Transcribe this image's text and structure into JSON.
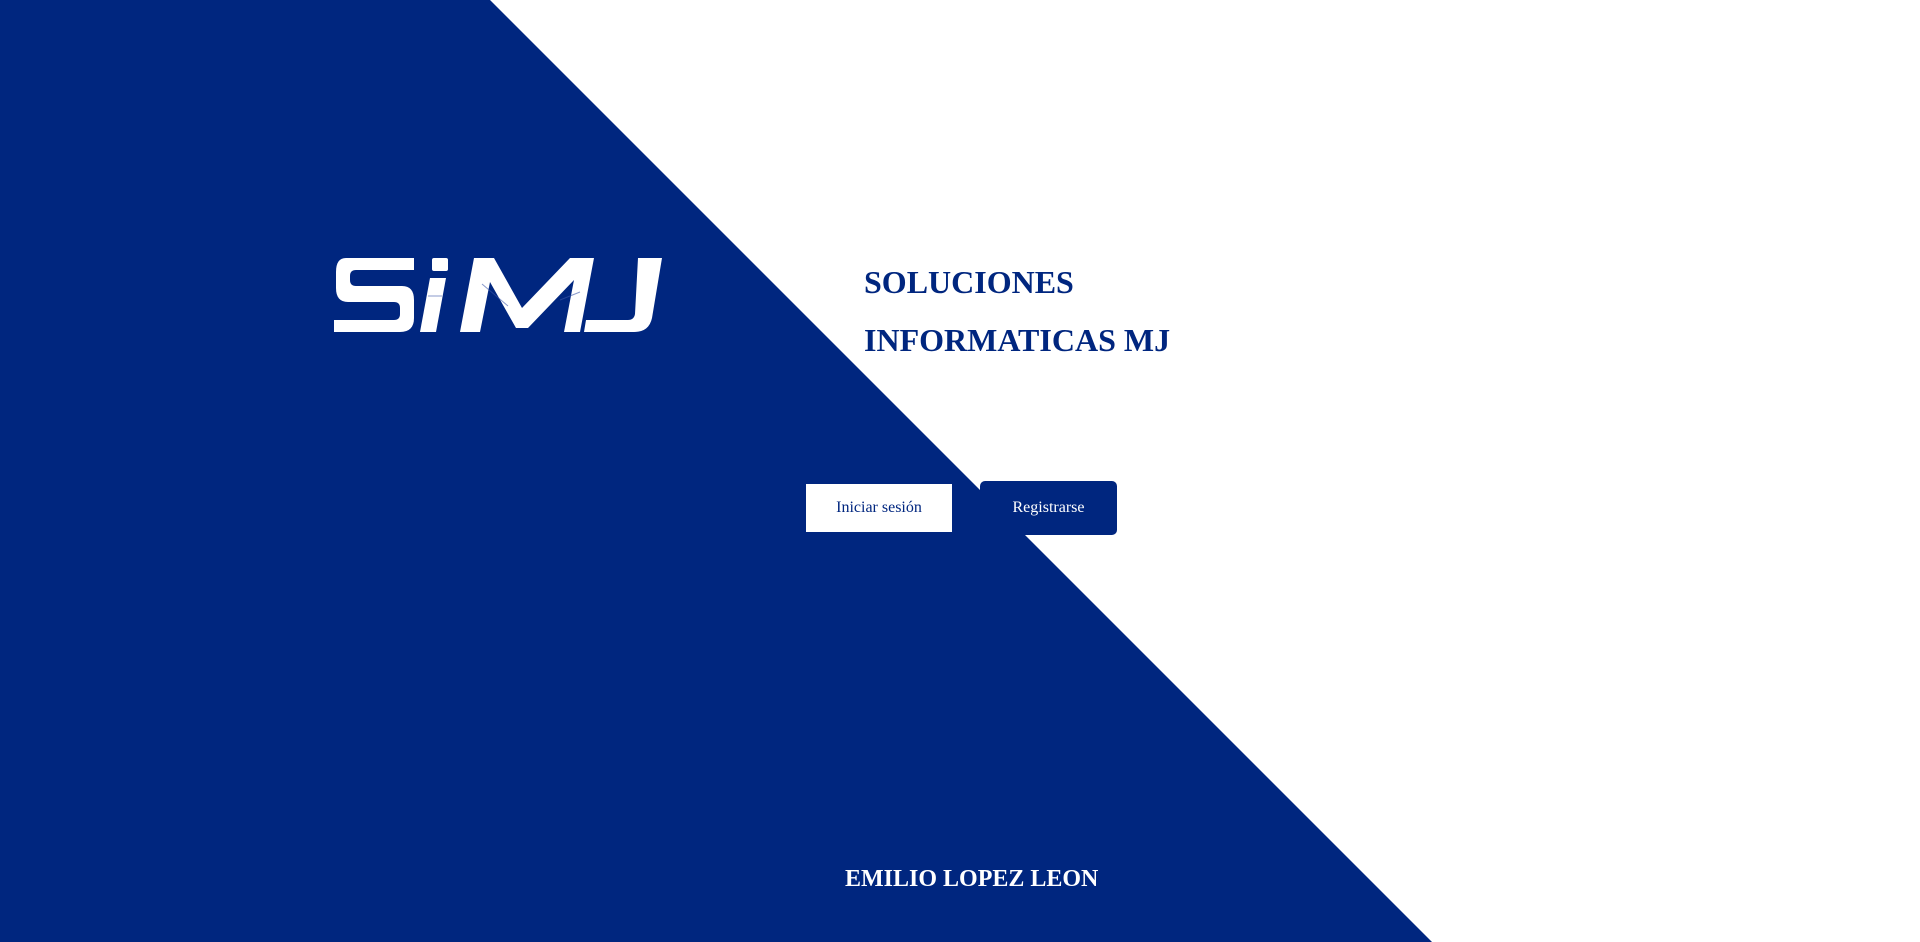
{
  "brand": {
    "logo_text": "SiMJ",
    "company_line1": "SOLUCIONES",
    "company_line2": "INFORMATICAS MJ"
  },
  "actions": {
    "login_label": "Iniciar sesión",
    "register_label": "Registrarse"
  },
  "footer": {
    "author": "EMILIO LOPEZ LEON"
  },
  "colors": {
    "primary": "#00267f",
    "background": "#ffffff",
    "on_primary": "#ffffff"
  }
}
